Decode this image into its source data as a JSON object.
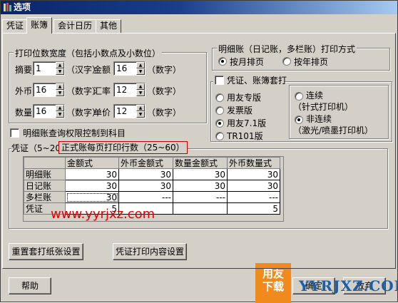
{
  "window": {
    "title": "选项"
  },
  "tabs": [
    {
      "label": "凭证"
    },
    {
      "label": "账簿"
    },
    {
      "label": "会计日历"
    },
    {
      "label": "其他"
    }
  ],
  "print_width_group": {
    "title": "打印位数宽度（包括小数点及小数位）",
    "fields": [
      {
        "label": "摘要",
        "value": "1",
        "unit": "（汉字）"
      },
      {
        "label": "金额",
        "value": "16",
        "unit": "（数字）"
      },
      {
        "label": "外币",
        "value": "16",
        "unit": "（数字）"
      },
      {
        "label": "汇率",
        "value": "12",
        "unit": "（数字）"
      },
      {
        "label": "数量",
        "value": "16",
        "unit": "（数字）"
      },
      {
        "label": "单价",
        "value": "12",
        "unit": "（数字）"
      }
    ]
  },
  "query_permission_checkbox": {
    "label": "明细账查询权限控制到科目",
    "checked": false
  },
  "detail_print_group": {
    "title": "明细账（日记账，多栏账）打印方式",
    "options": [
      {
        "label": "按月排页",
        "selected": true
      },
      {
        "label": "按年排页",
        "selected": false
      }
    ]
  },
  "voucher_set_print": {
    "checkbox_label": "凭证、账簿套打",
    "checked": false,
    "versions": [
      {
        "label": "用友专版",
        "selected": false
      },
      {
        "label": "发票版",
        "selected": false
      },
      {
        "label": "用友7.1版",
        "selected": true
      },
      {
        "label": "TR101版",
        "selected": false
      }
    ],
    "paper_options": [
      {
        "line1": "连续",
        "line2": "（针式打印机）",
        "selected": false
      },
      {
        "line1": "非连续",
        "line2": "（激光/喷墨打印机）",
        "selected": true
      }
    ]
  },
  "rows_group": {
    "title_prefix": "凭证（5~20）、",
    "title_highlight": "正式账每页打印行数（25~60）",
    "highlight_color": "#c00000",
    "columns": [
      "金额式",
      "外币金额式",
      "数量金额式",
      "外币数量式"
    ],
    "rows": [
      {
        "label": "明细账",
        "cells": [
          "30",
          "30",
          "30",
          "30"
        ]
      },
      {
        "label": "日记账",
        "cells": [
          "30",
          "30",
          "30",
          "30"
        ]
      },
      {
        "label": "多栏账",
        "cells": [
          "30",
          "---",
          "---",
          "---"
        ]
      },
      {
        "label": "凭证",
        "cells": [
          "5",
          "",
          "",
          "5"
        ]
      }
    ]
  },
  "buttons": {
    "reset_paper": "重置套打纸张设置",
    "voucher_print_content": "凭证打印内容设置",
    "help": "帮助",
    "ok": "确定",
    "cancel": "放弃"
  },
  "watermarks": {
    "url": "www.yyrjxz.com",
    "logo": "用友下载",
    "site": "YYRJXZ.COM",
    "url_color": "#e00000",
    "logo_color": "#f08a1c",
    "site_color": "#1a5fa8"
  }
}
